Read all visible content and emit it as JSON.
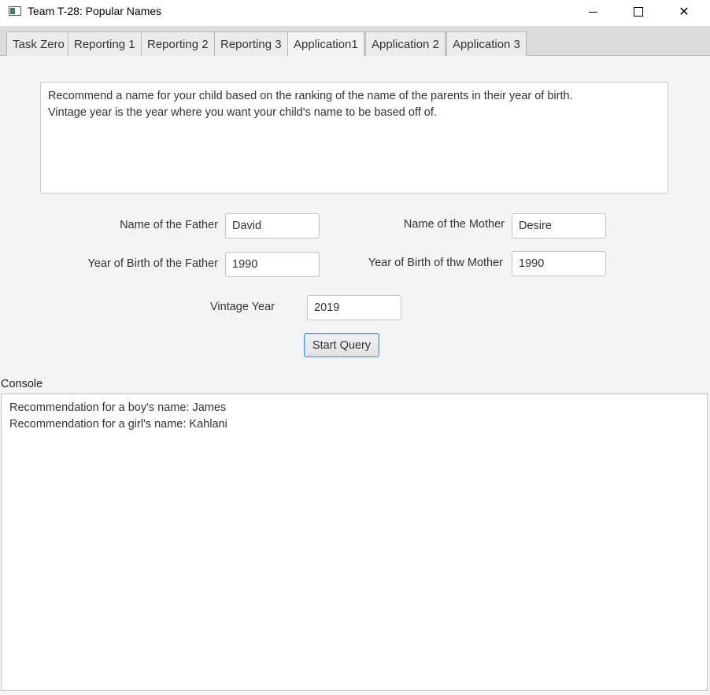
{
  "window": {
    "title": "Team T-28: Popular Names",
    "icon": "app-window-icon"
  },
  "tabs": [
    {
      "label": "Task Zero"
    },
    {
      "label": "Reporting 1"
    },
    {
      "label": "Reporting 2"
    },
    {
      "label": "Reporting 3"
    },
    {
      "label": "Application1",
      "active": true
    },
    {
      "label": "Application 2"
    },
    {
      "label": "Application 3"
    }
  ],
  "description": {
    "line1": "Recommend a name for your child based on the ranking of the name of the parents in their year of birth.",
    "line2": "Vintage year is the year where you want your child's name to be based off of."
  },
  "form": {
    "father_name_label": "Name of the Father",
    "father_name_value": "David",
    "mother_name_label": "Name of the Mother",
    "mother_name_value": "Desire",
    "father_yob_label": "Year of Birth of the Father",
    "father_yob_value": "1990",
    "mother_yob_label": "Year of Birth of thw Mother",
    "mother_yob_value": "1990",
    "vintage_label": "Vintage Year",
    "vintage_value": "2019",
    "start_button": "Start Query"
  },
  "console": {
    "label": "Console",
    "lines": [
      "Recommendation for a boy's name: James",
      "Recommendation for a girl's name: Kahlani"
    ]
  },
  "colors": {
    "accent": "#3a9ad9",
    "background": "#f4f4f4"
  }
}
